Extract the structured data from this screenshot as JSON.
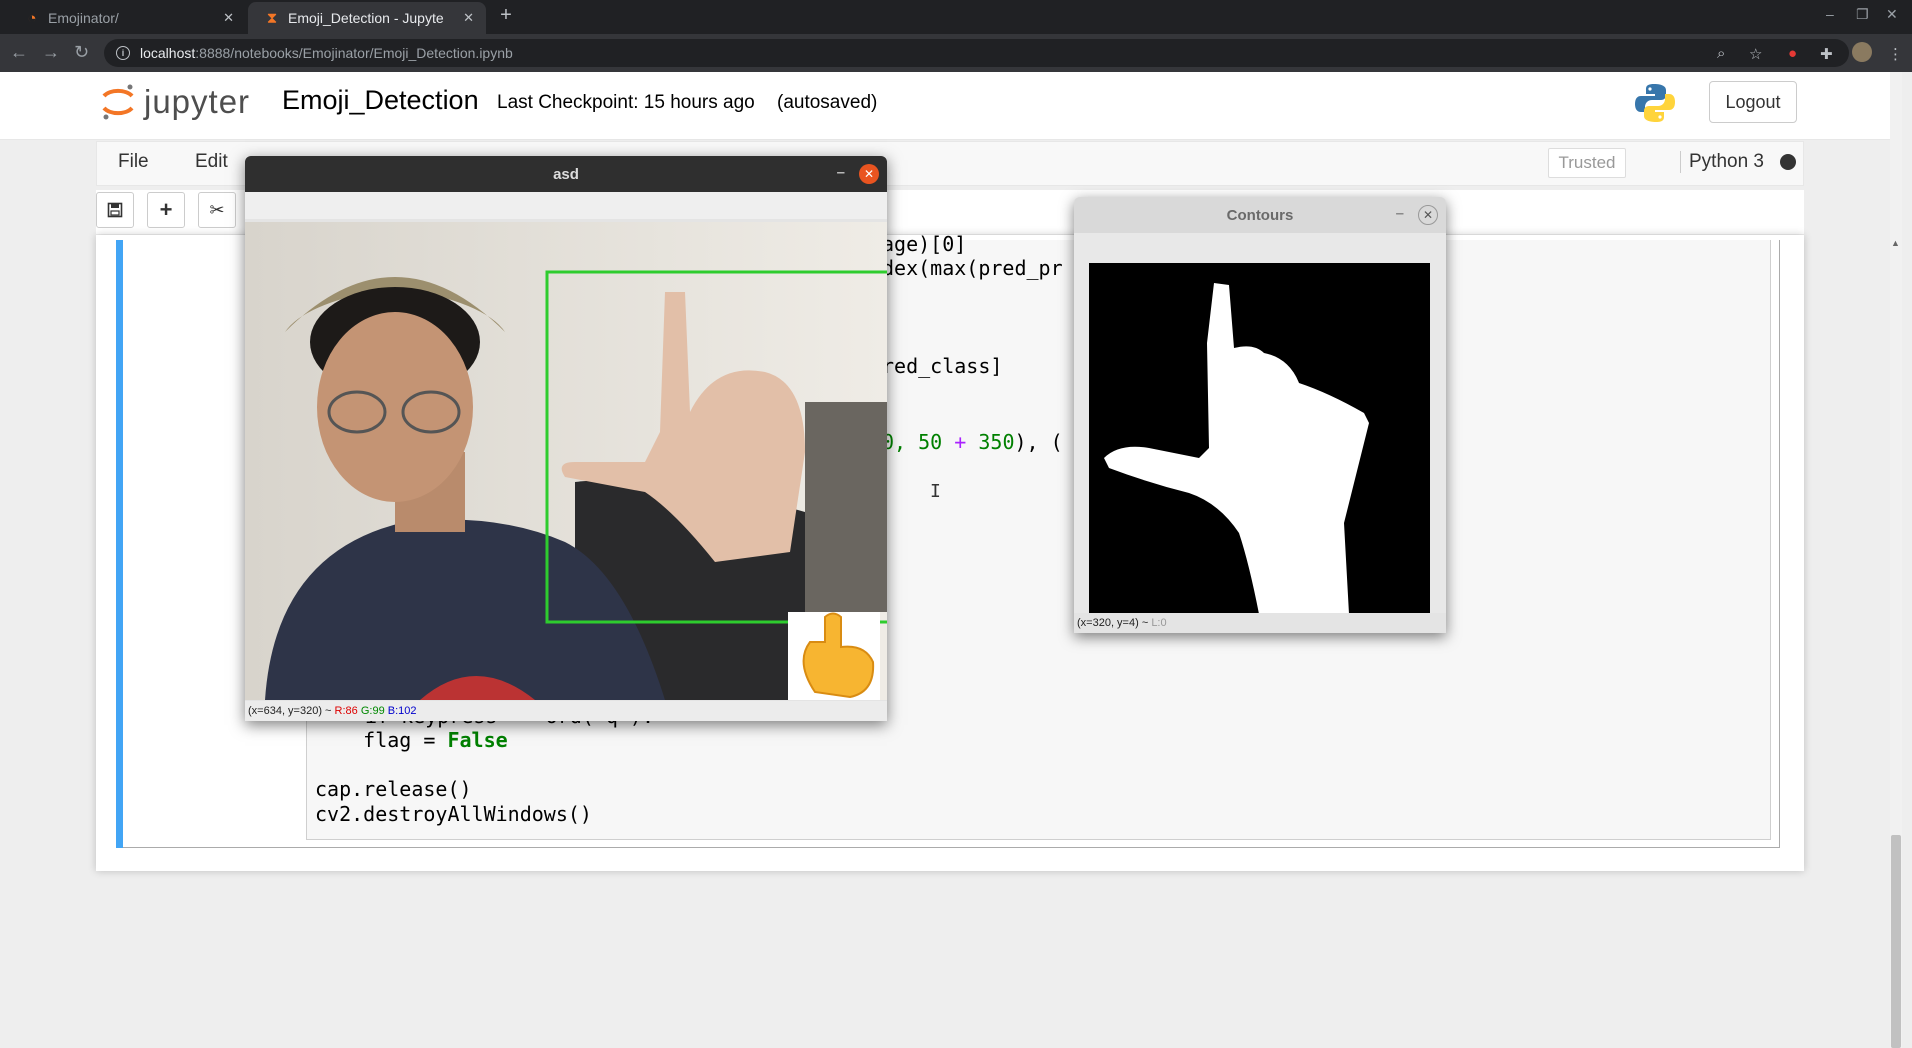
{
  "browser": {
    "tabs": [
      {
        "title": "Emojinator/",
        "icon": "jupyter-icon"
      },
      {
        "title": "Emoji_Detection - Jupyte",
        "icon": "hourglass-icon"
      }
    ],
    "url_host": "localhost",
    "url_path": ":8888/notebooks/Emojinator/Emoji_Detection.ipynb"
  },
  "header": {
    "logo_text": "jupyter",
    "notebook_title": "Emoji_Detection",
    "checkpoint": "Last Checkpoint: 15 hours ago",
    "autosaved": "(autosaved)",
    "logout": "Logout"
  },
  "menubar": {
    "items": [
      "File",
      "Edit"
    ],
    "trusted": "Trusted",
    "kernel": "Python 3"
  },
  "code": {
    "l1": "age)[0]",
    "l2": "dex(max(pred_pr",
    "l3": "red_class]",
    "l4_pre": "0, ",
    "l4_n": "50",
    "l4_op": "+",
    "l4_n2": "350",
    "l4_post": "), (",
    "l5": "if keypress == ord('q'):",
    "l6_pre": "    flag = ",
    "l6_kw": "False",
    "l7": "cap.release()",
    "l8": "cv2.destroyAllWindows()"
  },
  "windows": {
    "asd": {
      "title": "asd",
      "status": "(x=634, y=320) ~",
      "r": "R:86",
      "g": "G:99",
      "b": "B:102"
    },
    "contours": {
      "title": "Contours",
      "status": "(x=320, y=4) ~",
      "l": "L:0"
    }
  },
  "colors": {
    "accent": "#42a5f5",
    "jupyter_orange": "#f37626",
    "close_orange": "#e95420",
    "roi_green": "#2ecc2e"
  }
}
